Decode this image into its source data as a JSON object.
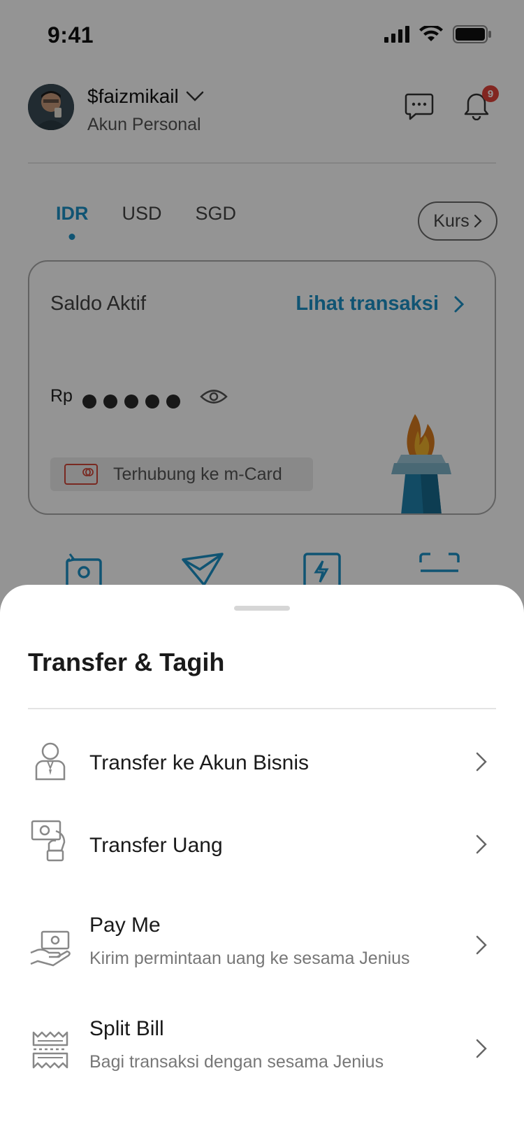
{
  "status_bar": {
    "time": "9:41"
  },
  "header": {
    "username": "$faizmikail",
    "account_type": "Akun Personal",
    "notification_count": "9"
  },
  "currency_tabs": [
    {
      "label": "IDR",
      "active": true
    },
    {
      "label": "USD",
      "active": false
    },
    {
      "label": "SGD",
      "active": false
    }
  ],
  "kurs_label": "Kurs",
  "balance": {
    "label": "Saldo Aktif",
    "see_transactions": "Lihat transaksi",
    "currency_symbol": "Rp",
    "linked_card": "Terhubung ke m-Card"
  },
  "sheet": {
    "title": "Transfer & Tagih",
    "items": [
      {
        "label": "Transfer ke Akun Bisnis",
        "subtitle": "",
        "icon": "business-person-icon"
      },
      {
        "label": "Transfer Uang",
        "subtitle": "",
        "icon": "money-transfer-icon"
      },
      {
        "label": "Pay Me",
        "subtitle": "Kirim permintaan uang ke sesama Jenius",
        "icon": "hand-money-icon"
      },
      {
        "label": "Split Bill",
        "subtitle": "Bagi transaksi dengan sesama Jenius",
        "icon": "receipt-split-icon"
      }
    ]
  },
  "colors": {
    "accent": "#1c92c6",
    "badge": "#e1423a",
    "overlay": "rgba(0,0,0,0.42)"
  }
}
